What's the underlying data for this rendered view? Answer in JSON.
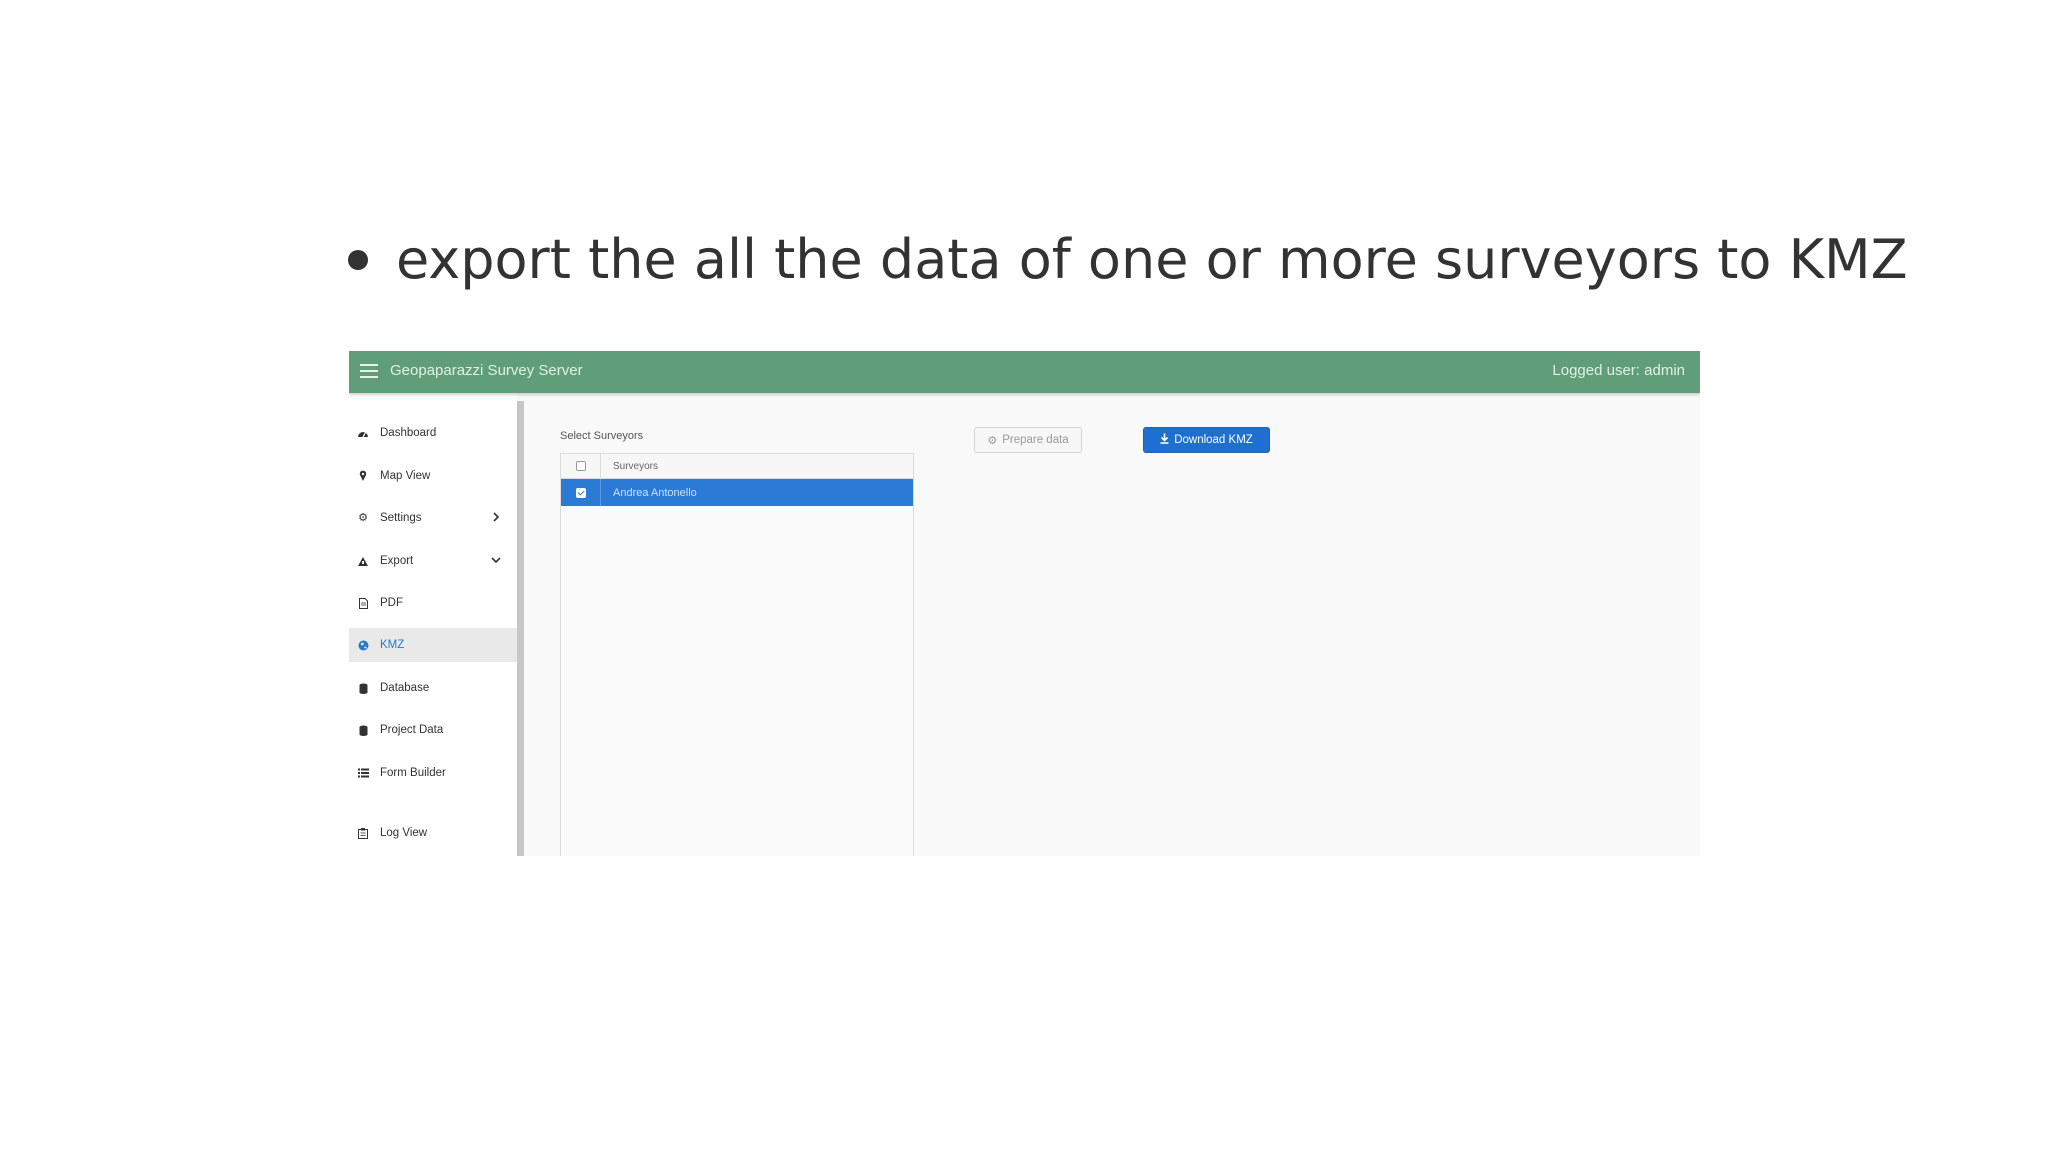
{
  "slide": {
    "bullet_text": "export the all the data of one or more surveyors to KMZ"
  },
  "topbar": {
    "title": "Geopaparazzi Survey Server",
    "logged_user": "Logged user: admin",
    "color": "#5f9e78"
  },
  "sidebar": {
    "items": [
      {
        "label": "Dashboard",
        "icon": "dashboard-icon"
      },
      {
        "label": "Map View",
        "icon": "map-pin-icon"
      },
      {
        "label": "Settings",
        "icon": "gears-icon"
      },
      {
        "label": "Export",
        "icon": "export-icon"
      },
      {
        "label": "PDF",
        "icon": "file-icon"
      },
      {
        "label": "KMZ",
        "icon": "globe-icon",
        "active": true
      },
      {
        "label": "Database",
        "icon": "database-icon"
      },
      {
        "label": "Project Data",
        "icon": "database-icon"
      },
      {
        "label": "Form Builder",
        "icon": "list-icon"
      },
      {
        "label": "Log View",
        "icon": "log-icon"
      }
    ]
  },
  "main": {
    "select_label": "Select Surveyors",
    "grid": {
      "column_header": "Surveyors",
      "rows": [
        {
          "name": "Andrea Antonello",
          "checked": true
        }
      ]
    },
    "prepare_label": "Prepare data",
    "download_label": "Download KMZ"
  },
  "colors": {
    "accent": "#1f6fd1",
    "selected_row": "#2b7bd6",
    "active_nav": "#2b78c9"
  }
}
